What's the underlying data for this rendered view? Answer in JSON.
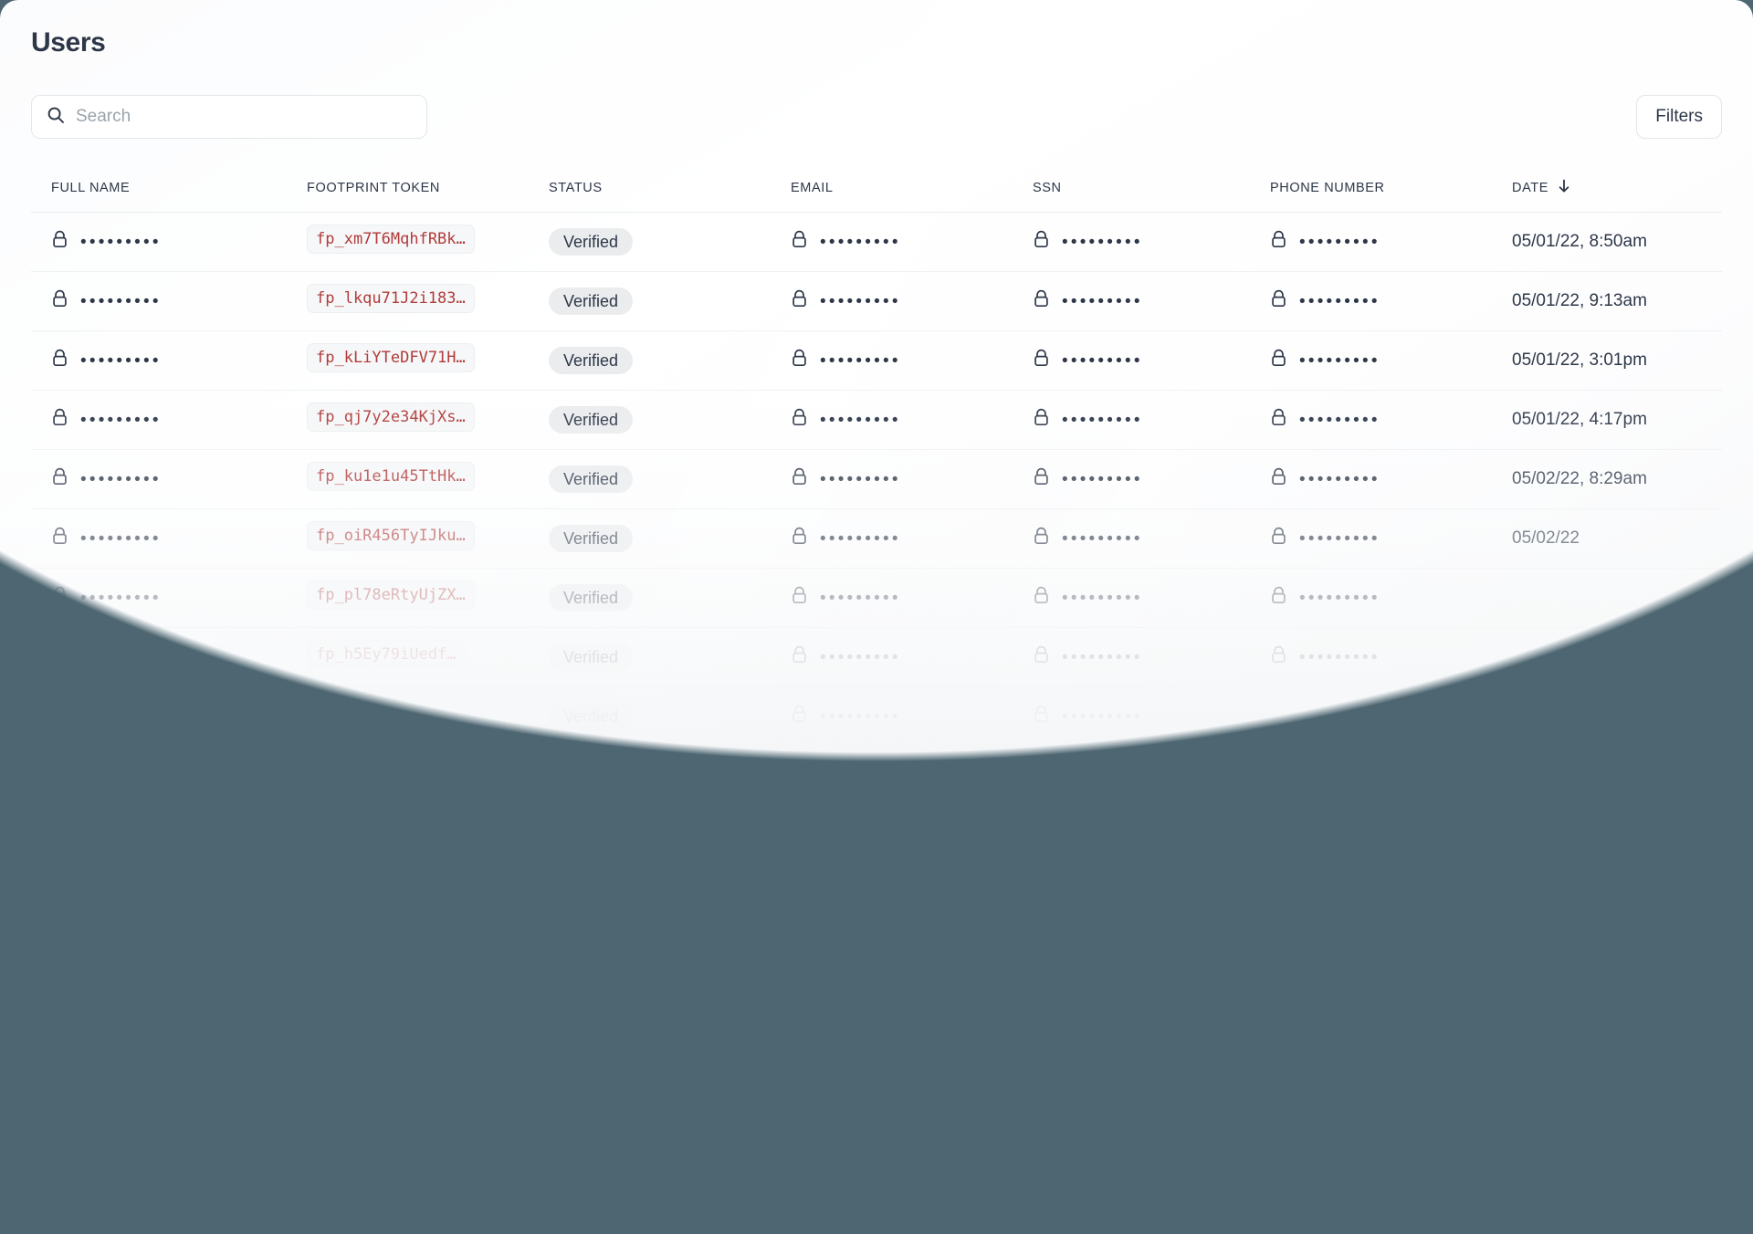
{
  "page": {
    "title": "Users",
    "background_color": "#4d6671",
    "card_color": "#ffffff"
  },
  "search": {
    "placeholder": "Search",
    "value": "",
    "icon": "search-icon"
  },
  "filters": {
    "label": "Filters"
  },
  "table": {
    "columns": [
      {
        "key": "full_name",
        "label": "FULL NAME",
        "sorted": false
      },
      {
        "key": "footprint_token",
        "label": "FOOTPRINT TOKEN",
        "sorted": false
      },
      {
        "key": "status",
        "label": "STATUS",
        "sorted": false
      },
      {
        "key": "email",
        "label": "EMAIL",
        "sorted": false
      },
      {
        "key": "ssn",
        "label": "SSN",
        "sorted": false
      },
      {
        "key": "phone_number",
        "label": "PHONE NUMBER",
        "sorted": false
      },
      {
        "key": "date",
        "label": "DATE",
        "sorted": true,
        "sort_icon": "arrow-down-icon"
      }
    ],
    "encrypted_mask": "•••••••••",
    "rows": [
      {
        "full_name": "•••••••••",
        "footprint_token": "fp_xm7T6MqhfRBk…",
        "status": "Verified",
        "email": "•••••••••",
        "ssn": "•••••••••",
        "phone_number": "•••••••••",
        "date": "05/01/22, 8:50am"
      },
      {
        "full_name": "•••••••••",
        "footprint_token": "fp_lkqu71J2i183…",
        "status": "Verified",
        "email": "•••••••••",
        "ssn": "•••••••••",
        "phone_number": "•••••••••",
        "date": "05/01/22, 9:13am"
      },
      {
        "full_name": "•••••••••",
        "footprint_token": "fp_kLiYTeDFV71H…",
        "status": "Verified",
        "email": "•••••••••",
        "ssn": "•••••••••",
        "phone_number": "•••••••••",
        "date": "05/01/22, 3:01pm"
      },
      {
        "full_name": "•••••••••",
        "footprint_token": "fp_qj7y2e34KjXs…",
        "status": "Verified",
        "email": "•••••••••",
        "ssn": "•••••••••",
        "phone_number": "•••••••••",
        "date": "05/01/22, 4:17pm"
      },
      {
        "full_name": "•••••••••",
        "footprint_token": "fp_ku1e1u45TtHk…",
        "status": "Verified",
        "email": "•••••••••",
        "ssn": "•••••••••",
        "phone_number": "•••••••••",
        "date": "05/02/22, 8:29am"
      },
      {
        "full_name": "•••••••••",
        "footprint_token": "fp_oiR456TyIJku…",
        "status": "Verified",
        "email": "•••••••••",
        "ssn": "•••••••••",
        "phone_number": "•••••••••",
        "date": "05/02/22"
      },
      {
        "full_name": "•••••••••",
        "footprint_token": "fp_pl78eRtyUjZX…",
        "status": "Verified",
        "email": "•••••••••",
        "ssn": "•••••••••",
        "phone_number": "•••••••••",
        "date": ""
      },
      {
        "full_name": "•••••••••",
        "footprint_token": "fp_h5Ey79iUedf…",
        "status": "Verified",
        "email": "•••••••••",
        "ssn": "•••••••••",
        "phone_number": "•••••••••",
        "date": ""
      },
      {
        "full_name": "•••••••••",
        "footprint_token": "",
        "status": "Verified",
        "email": "•••••••••",
        "ssn": "•••••••••",
        "phone_number": "",
        "date": ""
      }
    ]
  }
}
